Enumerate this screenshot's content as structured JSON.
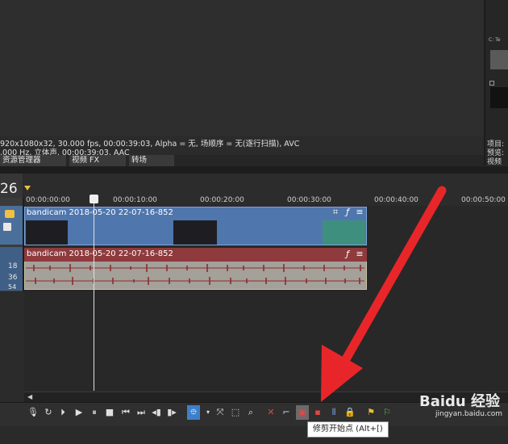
{
  "preview": {
    "properties_line1": "920x1080x32, 30.000 fps, 00:00:39:03, Alpha = 无, 场顺序 = 无(逐行扫描), AVC",
    "properties_line2": ",000 Hz, 立体声, 00:00:39:03, AAC",
    "side_text": "C: Te",
    "side_meta_1": "项目:",
    "side_meta_2": "预览:",
    "side_tab": "视频"
  },
  "tabs": [
    {
      "label": "资源管理器"
    },
    {
      "label": "视频 FX"
    },
    {
      "label": "转场"
    }
  ],
  "timeline": {
    "timecode": "26",
    "ruler_labels": [
      "00:00:00:00",
      "00:00:10:00",
      "00:00:20:00",
      "00:00:30:00",
      "00:00:40:00",
      "00:00:50:00"
    ],
    "audio_levels": [
      "18",
      "36",
      "54"
    ],
    "video_clip_title": "bandicam 2018-05-20 22-07-16-852",
    "audio_clip_title": "bandicam 2018-05-20 22-07-16-852"
  },
  "icons": {
    "crop": "crop-icon",
    "fx": "fx-icon",
    "menu": "menu-icon"
  },
  "tooltip": "修剪开始点 (Alt+[)",
  "watermark": {
    "text": "Baidu 经验",
    "sub": "jingyan.baidu.com"
  },
  "colors": {
    "video_clip": "#4f76ad",
    "audio_clip_header": "#8f3a3d",
    "arrow": "#e8262a",
    "snap_button": "#3f7fc8"
  }
}
